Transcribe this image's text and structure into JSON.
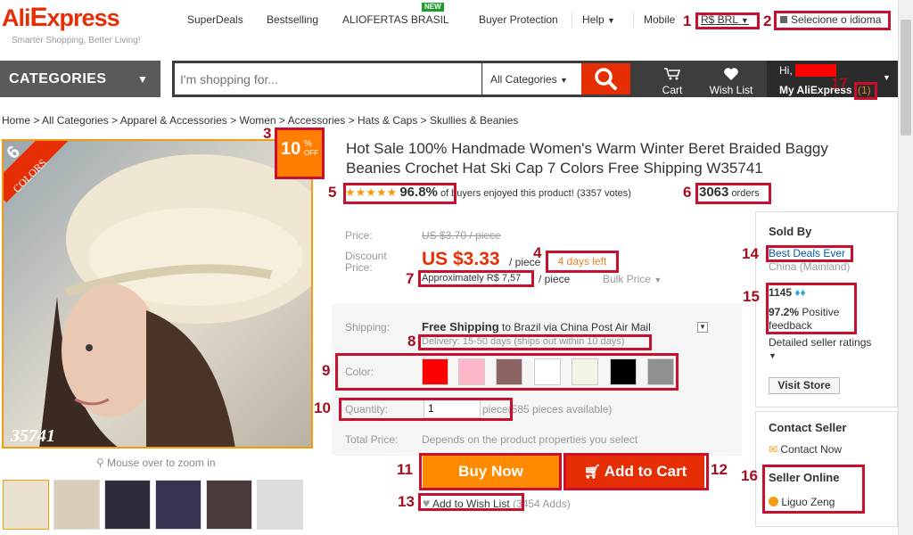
{
  "logo": {
    "ali": "Ali",
    "express": "xpress",
    "e_letter": "E",
    "tagline": "Smarter Shopping, Better Living!"
  },
  "top_nav": {
    "superdeals": "SuperDeals",
    "bestselling": "Bestselling",
    "aliofertas": "ALIOFERTAS BRASIL",
    "new_badge": "NEW",
    "buyer_protection": "Buyer Protection",
    "help": "Help",
    "mobile": "Mobile",
    "currency": "R$ BRL",
    "language": "Selecione o idioma"
  },
  "header": {
    "categories": "CATEGORIES",
    "search_placeholder": "I'm shopping for...",
    "search_category": "All Categories",
    "cart": "Cart",
    "wishlist": "Wish List",
    "hi": "Hi,",
    "my_aliexpress": "My AliExpress",
    "notification_count": "(1)"
  },
  "breadcrumb": "Home > All Categories > Apparel & Accessories > Women > Accessories > Hats & Caps > Skullies & Beanies",
  "product": {
    "title": "Hot Sale 100% Handmade Women's Warm Winter Beret Braided Baggy Beanies Crochet Hat Ski Cap 7 Colors Free Shipping W35741",
    "discount_badge_pct": "10",
    "discount_badge_sym": "%",
    "discount_badge_off": "OFF",
    "colors_ribbon_num": "6",
    "colors_ribbon_label": "COLORS",
    "image_code": "35741",
    "zoom_hint": "Mouse over to zoom in",
    "stars": "★★★★★",
    "rating_pct": "96.8%",
    "rating_text": "of buyers enjoyed this product! (3357 votes)",
    "orders_count": "3063",
    "orders_label": "orders"
  },
  "price": {
    "price_label": "Price:",
    "original": "US $3.70 / piece",
    "discount_label": "Discount Price:",
    "current": "US $3.33",
    "per_piece": "/ piece",
    "days_left": "4 days left",
    "approx": "Approximately R$ 7,57",
    "approx_per": "/ piece",
    "bulk": "Bulk Price"
  },
  "options": {
    "shipping_label": "Shipping:",
    "free_shipping": "Free Shipping",
    "shipping_dest": "to Brazil via China Post Air Mail",
    "delivery": "Delivery: 15-50 days (ships out within 10 days)",
    "color_label": "Color:",
    "colors": [
      "#ff0000",
      "#ffb6c8",
      "#8c6464",
      "#ffffff",
      "#f5f2e6",
      "#000000",
      "#909090"
    ],
    "quantity_label": "Quantity:",
    "quantity_value": "1",
    "quantity_unit": "piece",
    "quantity_available": "(585 pieces available)",
    "total_label": "Total Price:",
    "total_text": "Depends on the product properties you select"
  },
  "actions": {
    "buy_now": "Buy Now",
    "add_to_cart": "Add to Cart",
    "add_to_wishlist": "Add to Wish List",
    "wishlist_adds": "(3454 Adds)"
  },
  "seller": {
    "sold_by": "Sold By",
    "store_name": "Best Deals Ever",
    "location": "China (Mainland)",
    "score": "1145",
    "feedback_pct": "97.2%",
    "feedback_label": "Positive feedback",
    "detailed_ratings": "Detailed seller ratings",
    "visit_store": "Visit Store",
    "contact_seller": "Contact Seller",
    "contact_now": "Contact Now",
    "seller_online": "Seller Online",
    "seller_name": "Liguo Zeng"
  },
  "annotations": [
    "1",
    "2",
    "3",
    "4",
    "5",
    "6",
    "7",
    "8",
    "9",
    "10",
    "11",
    "12",
    "13",
    "14",
    "15",
    "16",
    "17"
  ],
  "colors": {
    "brand": "#e62e04",
    "buy": "#ff8a00",
    "annotation": "#c8102e"
  }
}
